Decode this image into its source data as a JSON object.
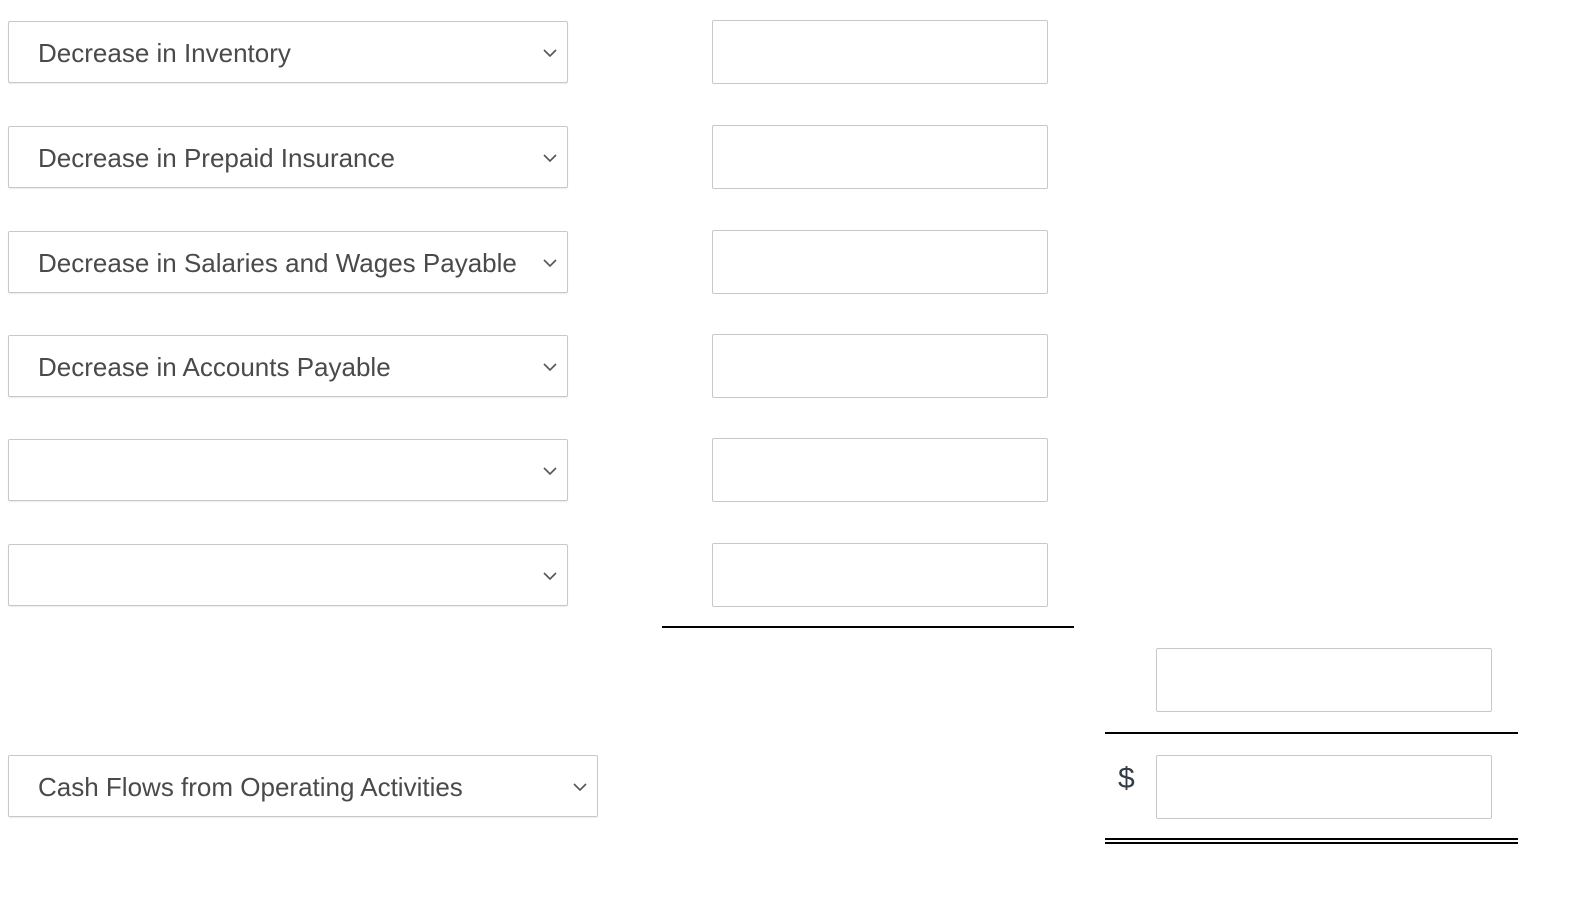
{
  "rows": [
    {
      "select": "Decrease in Inventory",
      "amount": ""
    },
    {
      "select": "Decrease in Prepaid Insurance",
      "amount": ""
    },
    {
      "select": "Decrease in Salaries and Wages Payable",
      "amount": ""
    },
    {
      "select": "Decrease in Accounts Payable",
      "amount": ""
    },
    {
      "select": "",
      "amount": ""
    },
    {
      "select": "",
      "amount": ""
    }
  ],
  "subtotal": {
    "amount": ""
  },
  "total": {
    "select": "Cash Flows from Operating Activities",
    "currency": "$",
    "amount": ""
  },
  "icons": {
    "dropdown": "chevron-down-icon"
  }
}
